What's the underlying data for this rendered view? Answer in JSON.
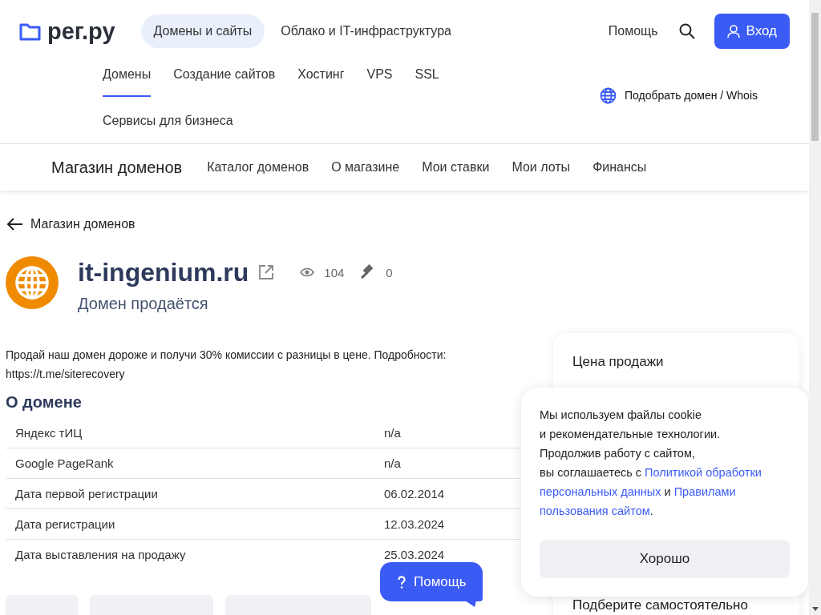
{
  "header": {
    "logo": "рег.ру",
    "top_nav": [
      {
        "label": "Домены и сайты",
        "selected": true
      },
      {
        "label": "Облако и IT-инфраструктура",
        "selected": false
      }
    ],
    "help": "Помощь",
    "login": "Вход",
    "sub_nav": [
      {
        "label": "Домены",
        "selected": true
      },
      {
        "label": "Создание сайтов",
        "selected": false
      },
      {
        "label": "Хостинг",
        "selected": false
      },
      {
        "label": "VPS",
        "selected": false
      },
      {
        "label": "SSL",
        "selected": false
      },
      {
        "label": "Сервисы для бизнеса",
        "selected": false
      }
    ],
    "whois_link": "Подобрать домен / Whois"
  },
  "shop_nav": {
    "title": "Магазин доменов",
    "items": [
      "Каталог доменов",
      "О магазине",
      "Мои ставки",
      "Мои лоты",
      "Финансы"
    ]
  },
  "back_link": "Магазин доменов",
  "domain": {
    "name": "it-ingenium.ru",
    "views": "104",
    "bids": "0",
    "status": "Домен продаётся"
  },
  "promo": "Продай наш домен дороже и получи 30% комиссии с разницы в цене. Подробности: https://t.me/siterecovery",
  "about": {
    "title": "О домене",
    "rows": [
      {
        "label": "Яндекс тИЦ",
        "value": "n/a"
      },
      {
        "label": "Google PageRank",
        "value": "n/a"
      },
      {
        "label": "Дата первой регистрации",
        "value": "06.02.2014"
      },
      {
        "label": "Дата регистрации",
        "value": "12.03.2024"
      },
      {
        "label": "Дата выставления на продажу",
        "value": "25.03.2024"
      }
    ]
  },
  "price_card": {
    "title": "Цена продажи",
    "footer": "Подберите самостоятельно"
  },
  "cookie": {
    "lines": [
      [
        {
          "kind": "text",
          "text": "Мы используем файлы cookie"
        }
      ],
      [
        {
          "kind": "text",
          "text": "и рекомендательные технологии."
        }
      ],
      [
        {
          "kind": "text",
          "text": "Продолжив работу с сайтом,"
        }
      ],
      [
        {
          "kind": "text",
          "text": "вы соглашаетесь с"
        },
        {
          "kind": "link",
          "text": "Политикой обработки"
        }
      ],
      [
        {
          "kind": "link",
          "text": "персональных данных"
        },
        {
          "kind": "text",
          "text": "и"
        },
        {
          "kind": "link",
          "text": "Правилами"
        }
      ],
      [
        {
          "kind": "link",
          "text": "пользования сайтом"
        },
        {
          "kind": "text",
          "text": "."
        }
      ]
    ],
    "button": "Хорошо"
  },
  "help_button": "Помощь"
}
